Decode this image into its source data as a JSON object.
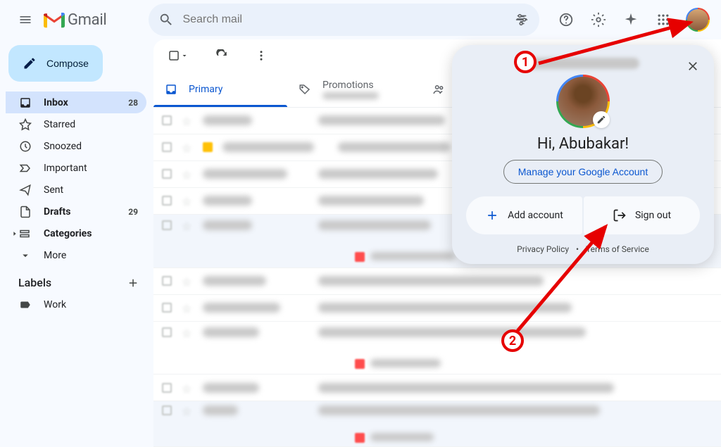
{
  "header": {
    "app_name": "Gmail",
    "search_placeholder": "Search mail"
  },
  "sidebar": {
    "compose_label": "Compose",
    "items": [
      {
        "label": "Inbox",
        "badge": "28"
      },
      {
        "label": "Starred",
        "badge": ""
      },
      {
        "label": "Snoozed",
        "badge": ""
      },
      {
        "label": "Important",
        "badge": ""
      },
      {
        "label": "Sent",
        "badge": ""
      },
      {
        "label": "Drafts",
        "badge": "29"
      },
      {
        "label": "Categories",
        "badge": ""
      },
      {
        "label": "More",
        "badge": ""
      }
    ],
    "labels_header": "Labels",
    "labels": [
      {
        "label": "Work"
      }
    ]
  },
  "tabs": {
    "primary": "Primary",
    "promotions": "Promotions",
    "social": ""
  },
  "account_popup": {
    "greeting": "Hi, Abubakar!",
    "manage_label": "Manage your Google Account",
    "add_account_label": "Add account",
    "sign_out_label": "Sign out",
    "privacy_label": "Privacy Policy",
    "terms_label": "Terms of Service"
  },
  "annotations": {
    "step1": "1",
    "step2": "2"
  }
}
